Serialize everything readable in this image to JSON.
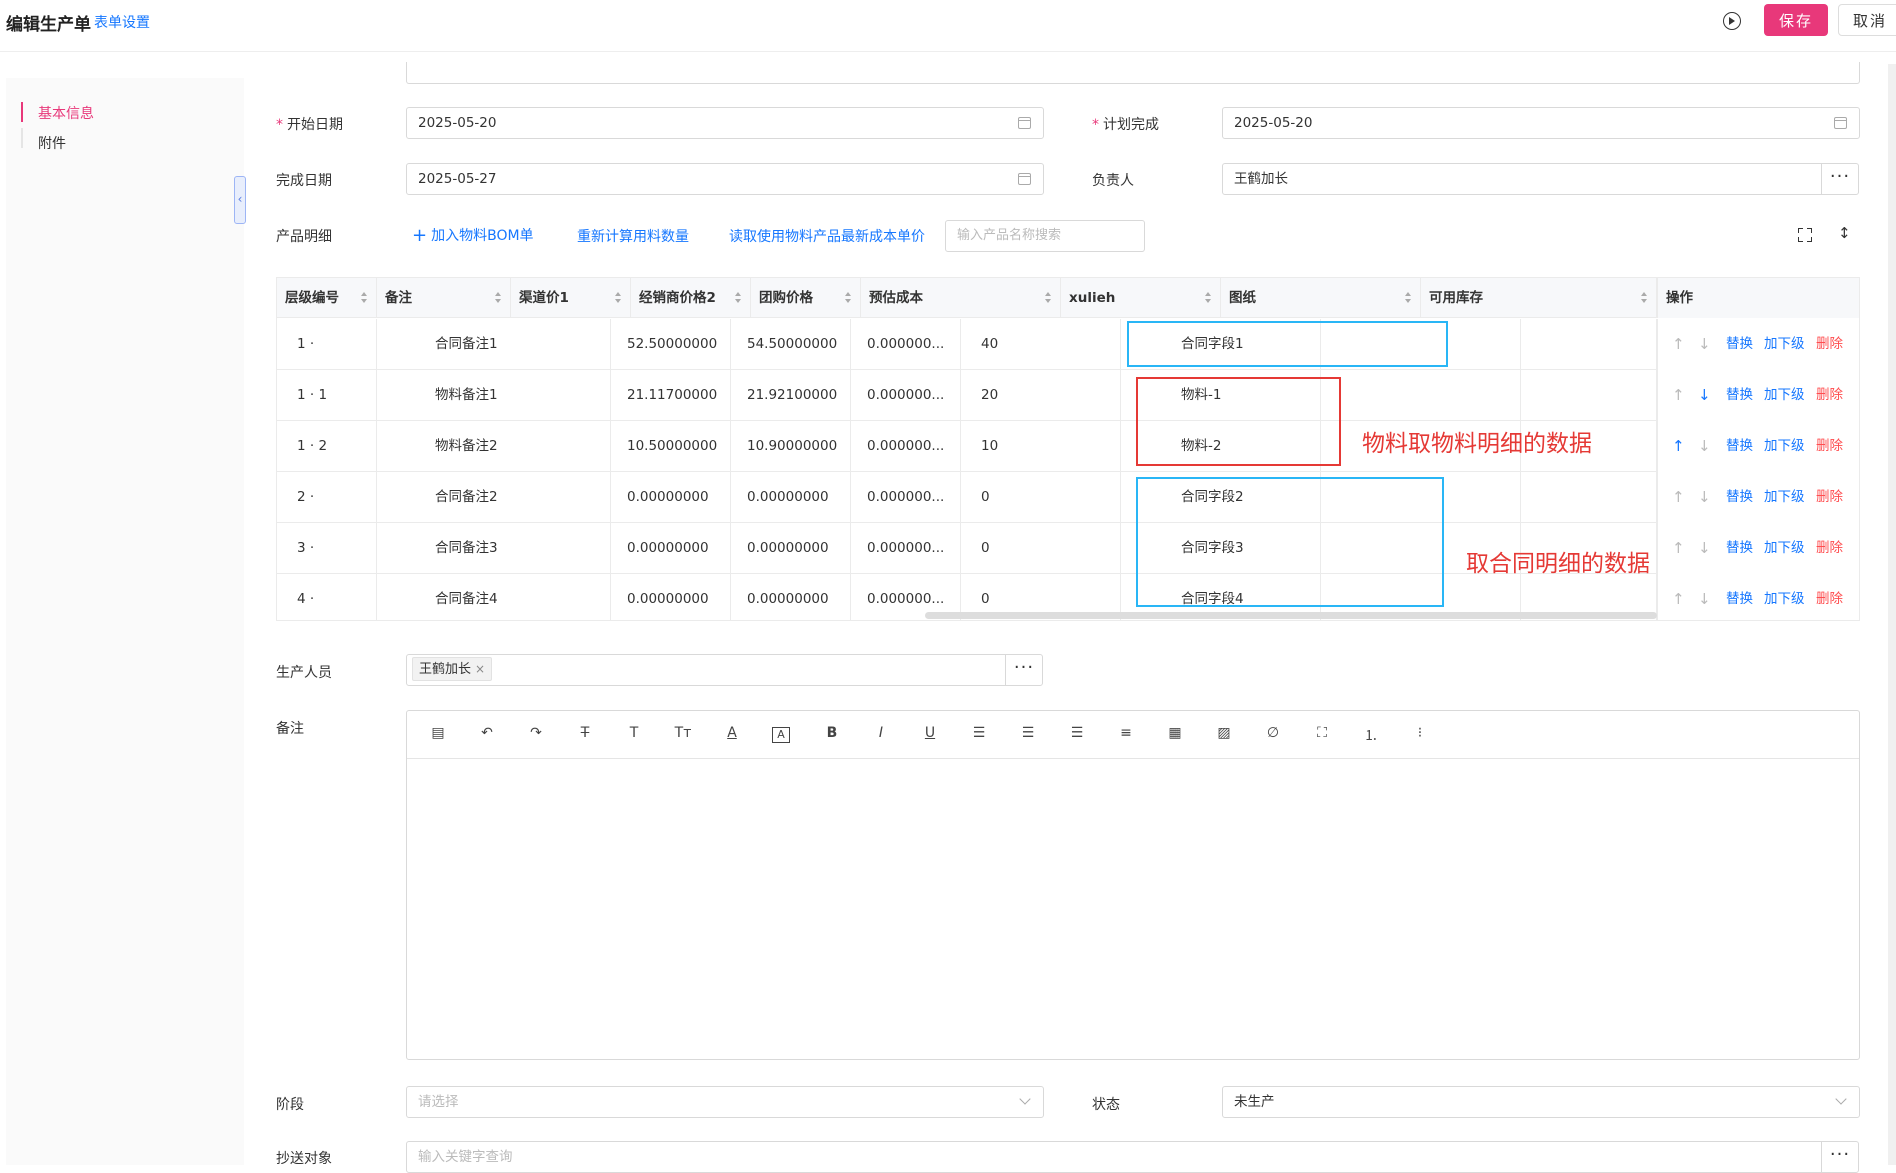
{
  "header": {
    "title": "编辑生产单",
    "form_settings": "表单设置",
    "save": "保存",
    "cancel": "取消"
  },
  "nav": {
    "items": [
      "基本信息",
      "附件"
    ]
  },
  "form": {
    "start_date_label": "开始日期",
    "start_date": "2025-05-20",
    "plan_done_label": "计划完成",
    "plan_done": "2025-05-20",
    "finish_date_label": "完成日期",
    "finish_date": "2025-05-27",
    "owner_label": "负责人",
    "owner": "王鹤加长",
    "product_detail_label": "产品明细",
    "add_bom": "加入物料BOM单",
    "recalc": "重新计算用料数量",
    "read_cost": "读取使用物料产品最新成本单价",
    "search_placeholder": "输入产品名称搜索",
    "producer_label": "生产人员",
    "producer_tag": "王鹤加长",
    "remark_label": "备注",
    "stage_label": "阶段",
    "stage_placeholder": "请选择",
    "status_label": "状态",
    "status": "未生产",
    "cc_label": "抄送对象",
    "cc_placeholder": "输入关键字查询"
  },
  "table": {
    "columns": [
      "层级编号",
      "备注",
      "渠道价1",
      "经销商价格2",
      "团购价格",
      "预估成本",
      "xulieh",
      "图纸",
      "可用库存",
      "操作"
    ],
    "rows": [
      {
        "level": "1 ·",
        "remark": "合同备注1",
        "price1": "52.50000000",
        "price2": "54.50000000",
        "group": "0.000000...",
        "cost": "40",
        "xulieh": "合同字段1",
        "up": false,
        "down": false
      },
      {
        "level": "1 · 1",
        "remark": "物料备注1",
        "price1": "21.11700000",
        "price2": "21.92100000",
        "group": "0.000000...",
        "cost": "20",
        "xulieh": "物料-1",
        "up": false,
        "down": true
      },
      {
        "level": "1 · 2",
        "remark": "物料备注2",
        "price1": "10.50000000",
        "price2": "10.90000000",
        "group": "0.000000...",
        "cost": "10",
        "xulieh": "物料-2",
        "up": true,
        "down": false
      },
      {
        "level": "2 ·",
        "remark": "合同备注2",
        "price1": "0.00000000",
        "price2": "0.00000000",
        "group": "0.000000...",
        "cost": "0",
        "xulieh": "合同字段2",
        "up": false,
        "down": false
      },
      {
        "level": "3 ·",
        "remark": "合同备注3",
        "price1": "0.00000000",
        "price2": "0.00000000",
        "group": "0.000000...",
        "cost": "0",
        "xulieh": "合同字段3",
        "up": false,
        "down": false
      },
      {
        "level": "4 ·",
        "remark": "合同备注4",
        "price1": "0.00000000",
        "price2": "0.00000000",
        "group": "0.000000...",
        "cost": "0",
        "xulieh": "合同字段4",
        "up": false,
        "down": false
      }
    ],
    "ops": {
      "replace": "替换",
      "add_child": "加下级",
      "delete": "删除"
    }
  },
  "annotations": {
    "material_note": "物料取物料明细的数据",
    "contract_note": "取合同明细的数据",
    "blue": "#29b6f6",
    "red": "#e53935"
  },
  "colors": {
    "accent": "#e8387a",
    "link": "#1677ff"
  }
}
